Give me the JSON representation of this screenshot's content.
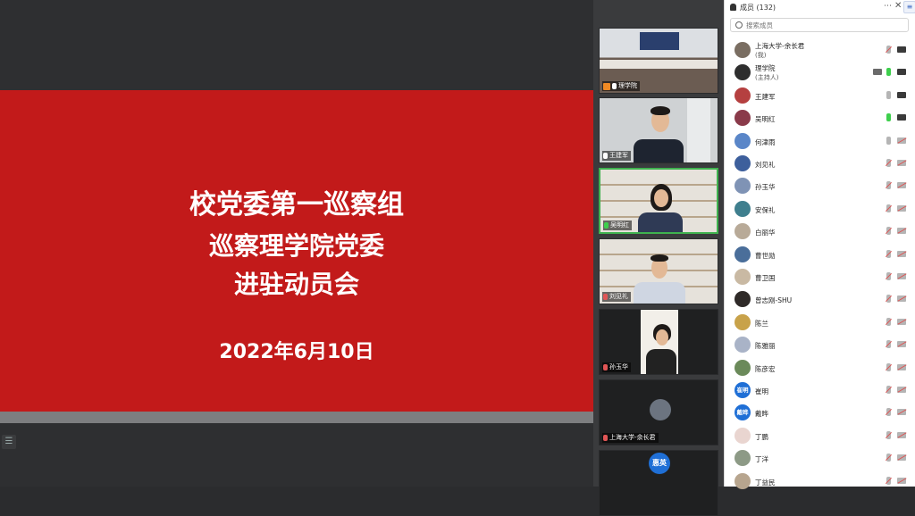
{
  "slide": {
    "line1": "校党委第一巡察组",
    "line2": "巡察理学院党委",
    "line3": "进驻动员会",
    "date": "2022年6月10日"
  },
  "videos": [
    {
      "name": "理学院",
      "host": true,
      "mic": "on",
      "scene": "room",
      "active": false
    },
    {
      "name": "王建军",
      "host": false,
      "mic": "on",
      "scene": "office",
      "active": false
    },
    {
      "name": "吴明红",
      "host": false,
      "mic": "green",
      "scene": "shelf-woman",
      "active": true
    },
    {
      "name": "刘见礼",
      "host": false,
      "mic": "off",
      "scene": "shelf-man",
      "active": false
    },
    {
      "name": "孙玉华",
      "host": false,
      "mic": "off",
      "scene": "portrait",
      "active": false
    },
    {
      "name": "上海大学-余长君",
      "host": false,
      "mic": "off",
      "scene": "avatar",
      "active": false
    },
    {
      "name": "",
      "host": false,
      "mic": "",
      "scene": "badge",
      "badge": "惠英",
      "active": false
    }
  ],
  "panel": {
    "title": "成员 (132)",
    "more_icon": "more-horizontal-icon",
    "close_icon": "close-icon",
    "search_placeholder": "搜索成员",
    "members": [
      {
        "name": "上海大学-余长君",
        "sub": "(我)",
        "avatar_color": "#7a6e62",
        "avatar_text": "",
        "mic": "off",
        "cam": "on",
        "share": false
      },
      {
        "name": "理学院",
        "sub": "(主持人)",
        "avatar_color": "#2e2e2e",
        "avatar_text": "",
        "mic": "on",
        "cam": "on",
        "share": true
      },
      {
        "name": "王建军",
        "sub": "",
        "avatar_color": "#b54040",
        "avatar_text": "",
        "mic": "plain",
        "cam": "on",
        "share": false
      },
      {
        "name": "吴明红",
        "sub": "",
        "avatar_color": "#8a3a4a",
        "avatar_text": "",
        "mic": "on",
        "cam": "on",
        "share": false
      },
      {
        "name": "何津雨",
        "sub": "",
        "avatar_color": "#5a86c8",
        "avatar_text": "",
        "mic": "plain",
        "cam": "off",
        "share": false
      },
      {
        "name": "刘见礼",
        "sub": "",
        "avatar_color": "#3d5f9c",
        "avatar_text": "",
        "mic": "off",
        "cam": "off",
        "share": false
      },
      {
        "name": "孙玉华",
        "sub": "",
        "avatar_color": "#7f93b5",
        "avatar_text": "",
        "mic": "off",
        "cam": "off",
        "share": false
      },
      {
        "name": "安保礼",
        "sub": "",
        "avatar_color": "#3f7f8e",
        "avatar_text": "",
        "mic": "off",
        "cam": "off",
        "share": false
      },
      {
        "name": "白丽华",
        "sub": "",
        "avatar_color": "#b8aa98",
        "avatar_text": "",
        "mic": "off",
        "cam": "off",
        "share": false
      },
      {
        "name": "曹世勋",
        "sub": "",
        "avatar_color": "#4a6e9a",
        "avatar_text": "",
        "mic": "off",
        "cam": "off",
        "share": false
      },
      {
        "name": "曹卫国",
        "sub": "",
        "avatar_color": "#c9b9a3",
        "avatar_text": "",
        "mic": "off",
        "cam": "off",
        "share": false
      },
      {
        "name": "曾志刚-SHU",
        "sub": "",
        "avatar_color": "#2f2a28",
        "avatar_text": "",
        "mic": "off",
        "cam": "off",
        "share": false
      },
      {
        "name": "陈兰",
        "sub": "",
        "avatar_color": "#c8a24a",
        "avatar_text": "",
        "mic": "off",
        "cam": "off",
        "share": false
      },
      {
        "name": "陈雅丽",
        "sub": "",
        "avatar_color": "#a9b3c7",
        "avatar_text": "",
        "mic": "off",
        "cam": "off",
        "share": false
      },
      {
        "name": "陈彦宏",
        "sub": "",
        "avatar_color": "#6b8a5a",
        "avatar_text": "",
        "mic": "off",
        "cam": "off",
        "share": false
      },
      {
        "name": "崔明",
        "sub": "",
        "avatar_color": "#1f6fd6",
        "avatar_text": "崔明",
        "mic": "off",
        "cam": "off",
        "share": false
      },
      {
        "name": "戴晔",
        "sub": "",
        "avatar_color": "#1f6fd6",
        "avatar_text": "戴晔",
        "mic": "off",
        "cam": "off",
        "share": false
      },
      {
        "name": "丁鹏",
        "sub": "",
        "avatar_color": "#e9d5d0",
        "avatar_text": "",
        "mic": "off",
        "cam": "off",
        "share": false
      },
      {
        "name": "丁洋",
        "sub": "",
        "avatar_color": "#8d9a86",
        "avatar_text": "",
        "mic": "off",
        "cam": "off",
        "share": false
      },
      {
        "name": "丁益民",
        "sub": "",
        "avatar_color": "#b7a58e",
        "avatar_text": "",
        "mic": "off",
        "cam": "off",
        "share": false
      }
    ]
  }
}
